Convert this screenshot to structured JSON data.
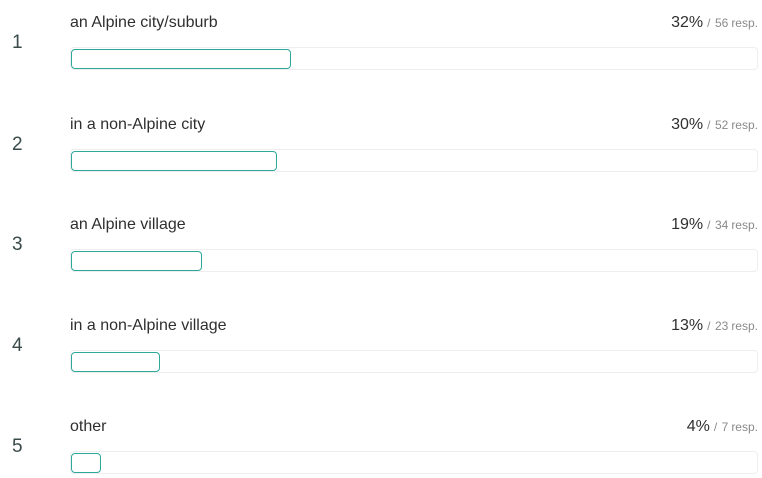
{
  "accent_color": "#2ea89a",
  "resp_unit": "resp.",
  "separator": "/",
  "results": [
    {
      "rank": "1",
      "label": "an Alpine city/suburb",
      "percent": "32%",
      "fraction": 0.32,
      "responses": "56"
    },
    {
      "rank": "2",
      "label": "in a non-Alpine city",
      "percent": "30%",
      "fraction": 0.3,
      "responses": "52"
    },
    {
      "rank": "3",
      "label": "an Alpine village",
      "percent": "19%",
      "fraction": 0.19,
      "responses": "34"
    },
    {
      "rank": "4",
      "label": "in a non-Alpine village",
      "percent": "13%",
      "fraction": 0.13,
      "responses": "23"
    },
    {
      "rank": "5",
      "label": "other",
      "percent": "4%",
      "fraction": 0.04,
      "responses": "7"
    }
  ]
}
